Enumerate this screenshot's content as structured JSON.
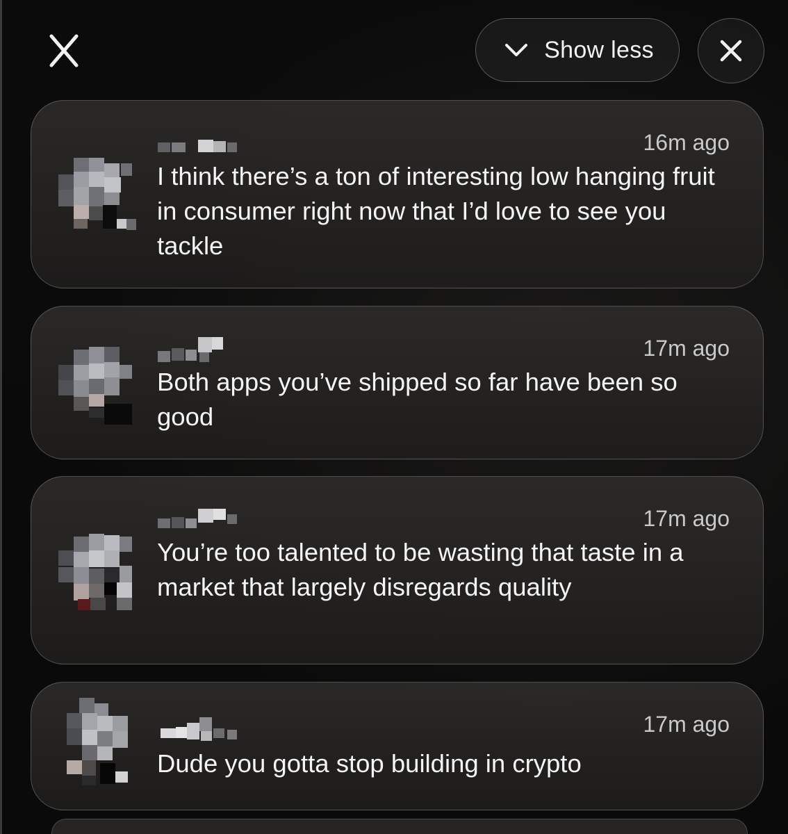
{
  "header": {
    "close_label": "X",
    "show_less_label": "Show less"
  },
  "notifications": [
    {
      "time": "16m ago",
      "message": "I think there’s a ton of interesting low hanging fruit in consumer right now that I’d love to see you tackle"
    },
    {
      "time": "17m ago",
      "message": "Both apps you’ve shipped so far have been so good"
    },
    {
      "time": "17m ago",
      "message": "You’re too talented to be wasting that taste in a market that largely disregards quality"
    },
    {
      "time": "17m ago",
      "message": "Dude you gotta stop building in crypto"
    }
  ],
  "icons": {
    "close_left": "close-x-icon",
    "show_less": "chevron-down-icon",
    "close_circle": "close-icon"
  },
  "colors": {
    "background": "#070707",
    "card": "#2a2928",
    "text": "#f5f5f5",
    "muted": "#c9c9c9"
  }
}
